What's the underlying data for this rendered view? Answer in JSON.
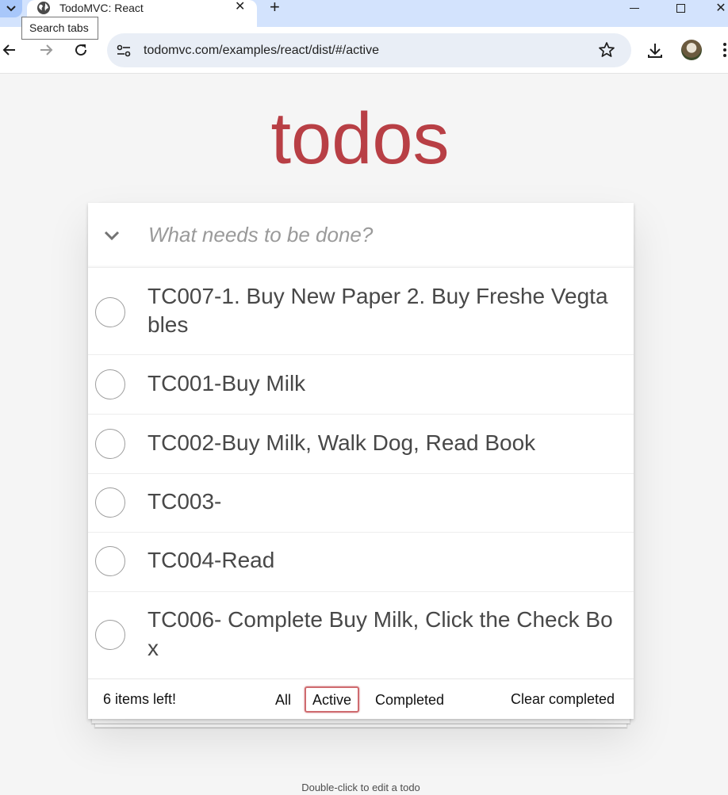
{
  "browser": {
    "tab_title": "TodoMVC: React",
    "tab_close": "✕",
    "new_tab": "+",
    "close_window": "✕",
    "tooltip": "Search tabs",
    "url": "todomvc.com/examples/react/dist/#/active",
    "icons": [
      "chevron-down-icon",
      "globe-icon",
      "back-arrow-icon",
      "forward-arrow-icon",
      "reload-icon",
      "site-info-icon",
      "star-icon",
      "download-icon",
      "kebab-menu-icon"
    ]
  },
  "app": {
    "title": "todos",
    "accent_color": "#b83f45",
    "new_todo_placeholder": "What needs to be done?",
    "todos": [
      {
        "label": "TC007-1. Buy New Paper 2. Buy Freshe Vegtables",
        "completed": false
      },
      {
        "label": "TC001-Buy Milk",
        "completed": false
      },
      {
        "label": "TC002-Buy Milk, Walk Dog, Read Book",
        "completed": false
      },
      {
        "label": "TC003-",
        "completed": false
      },
      {
        "label": "TC004-Read",
        "completed": false
      },
      {
        "label": "TC006- Complete Buy Milk, Click the Check Box",
        "completed": false
      }
    ],
    "footer": {
      "items_left": "6 items left!",
      "filters": [
        "All",
        "Active",
        "Completed"
      ],
      "selected_filter": "Active",
      "clear_completed": "Clear completed"
    },
    "info": "Double-click to edit a todo"
  }
}
